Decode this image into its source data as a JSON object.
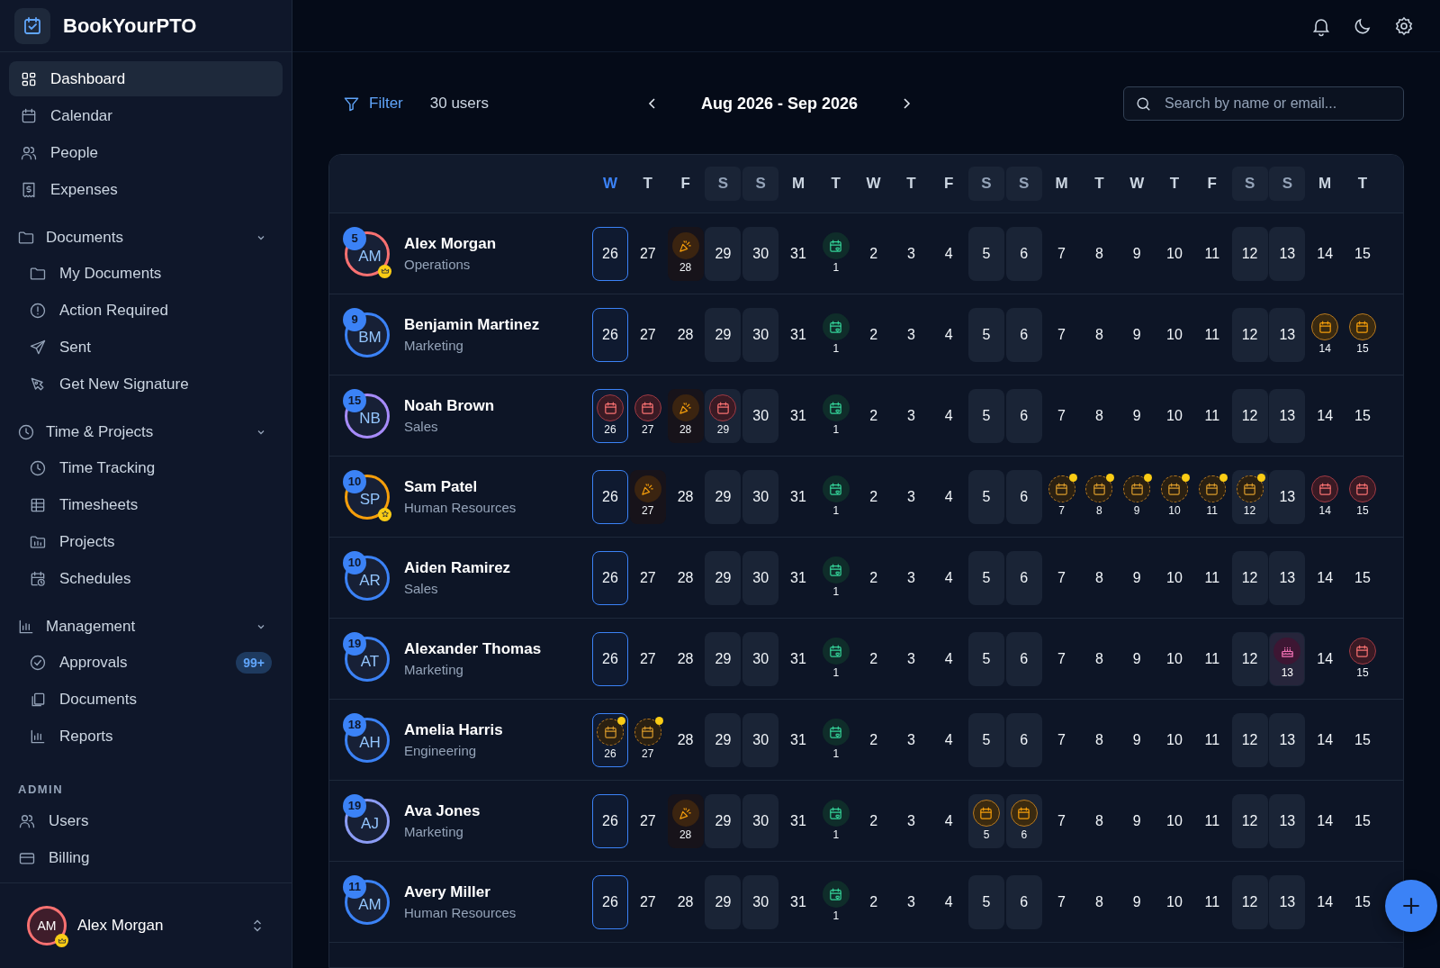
{
  "sidebar": {
    "brand": "BookYourPTO",
    "items": [
      {
        "label": "Dashboard",
        "selected": true
      },
      {
        "label": "Calendar",
        "selected": false
      },
      {
        "label": "People",
        "selected": false
      },
      {
        "label": "Expenses",
        "selected": false
      }
    ],
    "groups": [
      {
        "label": "Documents",
        "expanded": true,
        "items": [
          {
            "label": "My Documents",
            "selected": false
          },
          {
            "label": "Action Required",
            "selected": false
          },
          {
            "label": "Sent",
            "selected": false
          },
          {
            "label": "Get New Signature",
            "selected": false
          }
        ]
      },
      {
        "label": "Time & Projects",
        "expanded": true,
        "items": [
          {
            "label": "Time Tracking",
            "selected": false
          },
          {
            "label": "Timesheets",
            "selected": false
          },
          {
            "label": "Projects",
            "selected": false
          },
          {
            "label": "Schedules",
            "selected": false
          }
        ]
      },
      {
        "label": "Management",
        "expanded": true,
        "items": [
          {
            "label": "Approvals",
            "selected": false,
            "badge": "99+"
          },
          {
            "label": "Documents",
            "selected": false
          },
          {
            "label": "Reports",
            "selected": false
          }
        ]
      }
    ],
    "admin": {
      "heading": "ADMIN",
      "items": [
        {
          "label": "Users",
          "selected": false
        },
        {
          "label": "Billing",
          "selected": false
        }
      ]
    },
    "user": {
      "initials": "AM",
      "name": "Alex Morgan",
      "color": "#f87171",
      "badge": {
        "kind": "crown"
      }
    }
  },
  "toolbar": {
    "filter": "Filter",
    "count": "30 users",
    "range": "Aug 2026 - Sep 2026",
    "search": {
      "placeholder": "Search by name or email..."
    }
  },
  "calendar": {
    "columns": [
      {
        "letter": "W",
        "weekend": false,
        "today": true
      },
      {
        "letter": "T",
        "weekend": false,
        "today": false
      },
      {
        "letter": "F",
        "weekend": false,
        "today": false
      },
      {
        "letter": "S",
        "weekend": true,
        "today": false
      },
      {
        "letter": "S",
        "weekend": true,
        "today": false
      },
      {
        "letter": "M",
        "weekend": false,
        "today": false
      },
      {
        "letter": "T",
        "weekend": false,
        "today": false
      },
      {
        "letter": "W",
        "weekend": false,
        "today": false
      },
      {
        "letter": "T",
        "weekend": false,
        "today": false
      },
      {
        "letter": "F",
        "weekend": false,
        "today": false
      },
      {
        "letter": "S",
        "weekend": true,
        "today": false
      },
      {
        "letter": "S",
        "weekend": true,
        "today": false
      },
      {
        "letter": "M",
        "weekend": false,
        "today": false
      },
      {
        "letter": "T",
        "weekend": false,
        "today": false
      },
      {
        "letter": "W",
        "weekend": false,
        "today": false
      },
      {
        "letter": "T",
        "weekend": false,
        "today": false
      },
      {
        "letter": "F",
        "weekend": false,
        "today": false
      },
      {
        "letter": "S",
        "weekend": true,
        "today": false
      },
      {
        "letter": "S",
        "weekend": true,
        "today": false
      },
      {
        "letter": "M",
        "weekend": false,
        "today": false
      },
      {
        "letter": "T",
        "weekend": false,
        "today": false
      }
    ],
    "rows": [
      {
        "name": "Alex Morgan",
        "team": "Operations",
        "initials": "AM",
        "count": "5",
        "color": "#f87171",
        "badge": {
          "kind": "crown"
        },
        "days": [
          {
            "day": "26",
            "kind": "plain"
          },
          {
            "day": "27",
            "kind": "plain"
          },
          {
            "day": "28",
            "kind": "party"
          },
          {
            "day": "29",
            "kind": "plain"
          },
          {
            "day": "30",
            "kind": "plain"
          },
          {
            "day": "31",
            "kind": "plain"
          },
          {
            "day": "1",
            "kind": "holiday"
          },
          {
            "day": "2",
            "kind": "plain"
          },
          {
            "day": "3",
            "kind": "plain"
          },
          {
            "day": "4",
            "kind": "plain"
          },
          {
            "day": "5",
            "kind": "plain"
          },
          {
            "day": "6",
            "kind": "plain"
          },
          {
            "day": "7",
            "kind": "plain"
          },
          {
            "day": "8",
            "kind": "plain"
          },
          {
            "day": "9",
            "kind": "plain"
          },
          {
            "day": "10",
            "kind": "plain"
          },
          {
            "day": "11",
            "kind": "plain"
          },
          {
            "day": "12",
            "kind": "plain"
          },
          {
            "day": "13",
            "kind": "plain"
          },
          {
            "day": "14",
            "kind": "plain"
          },
          {
            "day": "15",
            "kind": "plain"
          }
        ]
      },
      {
        "name": "Benjamin Martinez",
        "team": "Marketing",
        "initials": "BM",
        "count": "9",
        "color": "#3b82f6",
        "days": [
          {
            "day": "26",
            "kind": "plain"
          },
          {
            "day": "27",
            "kind": "plain"
          },
          {
            "day": "28",
            "kind": "plain"
          },
          {
            "day": "29",
            "kind": "plain"
          },
          {
            "day": "30",
            "kind": "plain"
          },
          {
            "day": "31",
            "kind": "plain"
          },
          {
            "day": "1",
            "kind": "holiday"
          },
          {
            "day": "2",
            "kind": "plain"
          },
          {
            "day": "3",
            "kind": "plain"
          },
          {
            "day": "4",
            "kind": "plain"
          },
          {
            "day": "5",
            "kind": "plain"
          },
          {
            "day": "6",
            "kind": "plain"
          },
          {
            "day": "7",
            "kind": "plain"
          },
          {
            "day": "8",
            "kind": "plain"
          },
          {
            "day": "9",
            "kind": "plain"
          },
          {
            "day": "10",
            "kind": "plain"
          },
          {
            "day": "11",
            "kind": "plain"
          },
          {
            "day": "12",
            "kind": "plain"
          },
          {
            "day": "13",
            "kind": "plain"
          },
          {
            "day": "14",
            "kind": "vacation"
          },
          {
            "day": "15",
            "kind": "vacation"
          }
        ]
      },
      {
        "name": "Noah Brown",
        "team": "Sales",
        "initials": "NB",
        "count": "15",
        "color": "#a78bfa",
        "days": [
          {
            "day": "26",
            "kind": "leave"
          },
          {
            "day": "27",
            "kind": "leave"
          },
          {
            "day": "28",
            "kind": "party"
          },
          {
            "day": "29",
            "kind": "leave"
          },
          {
            "day": "30",
            "kind": "plain"
          },
          {
            "day": "31",
            "kind": "plain"
          },
          {
            "day": "1",
            "kind": "holiday"
          },
          {
            "day": "2",
            "kind": "plain"
          },
          {
            "day": "3",
            "kind": "plain"
          },
          {
            "day": "4",
            "kind": "plain"
          },
          {
            "day": "5",
            "kind": "plain"
          },
          {
            "day": "6",
            "kind": "plain"
          },
          {
            "day": "7",
            "kind": "plain"
          },
          {
            "day": "8",
            "kind": "plain"
          },
          {
            "day": "9",
            "kind": "plain"
          },
          {
            "day": "10",
            "kind": "plain"
          },
          {
            "day": "11",
            "kind": "plain"
          },
          {
            "day": "12",
            "kind": "plain"
          },
          {
            "day": "13",
            "kind": "plain"
          },
          {
            "day": "14",
            "kind": "plain"
          },
          {
            "day": "15",
            "kind": "plain"
          }
        ]
      },
      {
        "name": "Sam Patel",
        "team": "Human Resources",
        "initials": "SP",
        "count": "10",
        "color": "#f59e0b",
        "badge": {
          "kind": "star"
        },
        "days": [
          {
            "day": "26",
            "kind": "plain"
          },
          {
            "day": "27",
            "kind": "party"
          },
          {
            "day": "28",
            "kind": "plain"
          },
          {
            "day": "29",
            "kind": "plain"
          },
          {
            "day": "30",
            "kind": "plain"
          },
          {
            "day": "31",
            "kind": "plain"
          },
          {
            "day": "1",
            "kind": "holiday"
          },
          {
            "day": "2",
            "kind": "plain"
          },
          {
            "day": "3",
            "kind": "plain"
          },
          {
            "day": "4",
            "kind": "plain"
          },
          {
            "day": "5",
            "kind": "plain"
          },
          {
            "day": "6",
            "kind": "plain"
          },
          {
            "day": "7",
            "kind": "pending"
          },
          {
            "day": "8",
            "kind": "pending"
          },
          {
            "day": "9",
            "kind": "pending"
          },
          {
            "day": "10",
            "kind": "pending"
          },
          {
            "day": "11",
            "kind": "pending"
          },
          {
            "day": "12",
            "kind": "pending"
          },
          {
            "day": "13",
            "kind": "plain"
          },
          {
            "day": "14",
            "kind": "leave"
          },
          {
            "day": "15",
            "kind": "leave"
          }
        ]
      },
      {
        "name": "Aiden Ramirez",
        "team": "Sales",
        "initials": "AR",
        "count": "10",
        "color": "#3b82f6",
        "days": [
          {
            "day": "26",
            "kind": "plain"
          },
          {
            "day": "27",
            "kind": "plain"
          },
          {
            "day": "28",
            "kind": "plain"
          },
          {
            "day": "29",
            "kind": "plain"
          },
          {
            "day": "30",
            "kind": "plain"
          },
          {
            "day": "31",
            "kind": "plain"
          },
          {
            "day": "1",
            "kind": "holiday"
          },
          {
            "day": "2",
            "kind": "plain"
          },
          {
            "day": "3",
            "kind": "plain"
          },
          {
            "day": "4",
            "kind": "plain"
          },
          {
            "day": "5",
            "kind": "plain"
          },
          {
            "day": "6",
            "kind": "plain"
          },
          {
            "day": "7",
            "kind": "plain"
          },
          {
            "day": "8",
            "kind": "plain"
          },
          {
            "day": "9",
            "kind": "plain"
          },
          {
            "day": "10",
            "kind": "plain"
          },
          {
            "day": "11",
            "kind": "plain"
          },
          {
            "day": "12",
            "kind": "plain"
          },
          {
            "day": "13",
            "kind": "plain"
          },
          {
            "day": "14",
            "kind": "plain"
          },
          {
            "day": "15",
            "kind": "plain"
          }
        ]
      },
      {
        "name": "Alexander Thomas",
        "team": "Marketing",
        "initials": "AT",
        "count": "19",
        "color": "#3b82f6",
        "days": [
          {
            "day": "26",
            "kind": "plain"
          },
          {
            "day": "27",
            "kind": "plain"
          },
          {
            "day": "28",
            "kind": "plain"
          },
          {
            "day": "29",
            "kind": "plain"
          },
          {
            "day": "30",
            "kind": "plain"
          },
          {
            "day": "31",
            "kind": "plain"
          },
          {
            "day": "1",
            "kind": "holiday"
          },
          {
            "day": "2",
            "kind": "plain"
          },
          {
            "day": "3",
            "kind": "plain"
          },
          {
            "day": "4",
            "kind": "plain"
          },
          {
            "day": "5",
            "kind": "plain"
          },
          {
            "day": "6",
            "kind": "plain"
          },
          {
            "day": "7",
            "kind": "plain"
          },
          {
            "day": "8",
            "kind": "plain"
          },
          {
            "day": "9",
            "kind": "plain"
          },
          {
            "day": "10",
            "kind": "plain"
          },
          {
            "day": "11",
            "kind": "plain"
          },
          {
            "day": "12",
            "kind": "plain"
          },
          {
            "day": "13",
            "kind": "birthday"
          },
          {
            "day": "14",
            "kind": "plain"
          },
          {
            "day": "15",
            "kind": "leave"
          }
        ]
      },
      {
        "name": "Amelia Harris",
        "team": "Engineering",
        "initials": "AH",
        "count": "18",
        "color": "#3b82f6",
        "days": [
          {
            "day": "26",
            "kind": "pending"
          },
          {
            "day": "27",
            "kind": "pending"
          },
          {
            "day": "28",
            "kind": "plain"
          },
          {
            "day": "29",
            "kind": "plain"
          },
          {
            "day": "30",
            "kind": "plain"
          },
          {
            "day": "31",
            "kind": "plain"
          },
          {
            "day": "1",
            "kind": "holiday"
          },
          {
            "day": "2",
            "kind": "plain"
          },
          {
            "day": "3",
            "kind": "plain"
          },
          {
            "day": "4",
            "kind": "plain"
          },
          {
            "day": "5",
            "kind": "plain"
          },
          {
            "day": "6",
            "kind": "plain"
          },
          {
            "day": "7",
            "kind": "plain"
          },
          {
            "day": "8",
            "kind": "plain"
          },
          {
            "day": "9",
            "kind": "plain"
          },
          {
            "day": "10",
            "kind": "plain"
          },
          {
            "day": "11",
            "kind": "plain"
          },
          {
            "day": "12",
            "kind": "plain"
          },
          {
            "day": "13",
            "kind": "plain"
          },
          {
            "day": "14",
            "kind": "plain"
          },
          {
            "day": "15",
            "kind": "plain"
          }
        ]
      },
      {
        "name": "Ava Jones",
        "team": "Marketing",
        "initials": "AJ",
        "count": "19",
        "color": "#8b9cf5",
        "days": [
          {
            "day": "26",
            "kind": "plain"
          },
          {
            "day": "27",
            "kind": "plain"
          },
          {
            "day": "28",
            "kind": "party"
          },
          {
            "day": "29",
            "kind": "plain"
          },
          {
            "day": "30",
            "kind": "plain"
          },
          {
            "day": "31",
            "kind": "plain"
          },
          {
            "day": "1",
            "kind": "holiday"
          },
          {
            "day": "2",
            "kind": "plain"
          },
          {
            "day": "3",
            "kind": "plain"
          },
          {
            "day": "4",
            "kind": "plain"
          },
          {
            "day": "5",
            "kind": "vacation"
          },
          {
            "day": "6",
            "kind": "vacation"
          },
          {
            "day": "7",
            "kind": "plain"
          },
          {
            "day": "8",
            "kind": "plain"
          },
          {
            "day": "9",
            "kind": "plain"
          },
          {
            "day": "10",
            "kind": "plain"
          },
          {
            "day": "11",
            "kind": "plain"
          },
          {
            "day": "12",
            "kind": "plain"
          },
          {
            "day": "13",
            "kind": "plain"
          },
          {
            "day": "14",
            "kind": "plain"
          },
          {
            "day": "15",
            "kind": "plain"
          }
        ]
      },
      {
        "name": "Avery Miller",
        "team": "Human Resources",
        "initials": "AM",
        "count": "11",
        "color": "#3b82f6",
        "days": [
          {
            "day": "26",
            "kind": "plain"
          },
          {
            "day": "27",
            "kind": "plain"
          },
          {
            "day": "28",
            "kind": "plain"
          },
          {
            "day": "29",
            "kind": "plain"
          },
          {
            "day": "30",
            "kind": "plain"
          },
          {
            "day": "31",
            "kind": "plain"
          },
          {
            "day": "1",
            "kind": "holiday"
          },
          {
            "day": "2",
            "kind": "plain"
          },
          {
            "day": "3",
            "kind": "plain"
          },
          {
            "day": "4",
            "kind": "plain"
          },
          {
            "day": "5",
            "kind": "plain"
          },
          {
            "day": "6",
            "kind": "plain"
          },
          {
            "day": "7",
            "kind": "plain"
          },
          {
            "day": "8",
            "kind": "plain"
          },
          {
            "day": "9",
            "kind": "plain"
          },
          {
            "day": "10",
            "kind": "plain"
          },
          {
            "day": "11",
            "kind": "plain"
          },
          {
            "day": "12",
            "kind": "plain"
          },
          {
            "day": "13",
            "kind": "plain"
          },
          {
            "day": "14",
            "kind": "plain"
          },
          {
            "day": "15",
            "kind": "plain"
          }
        ]
      }
    ]
  }
}
